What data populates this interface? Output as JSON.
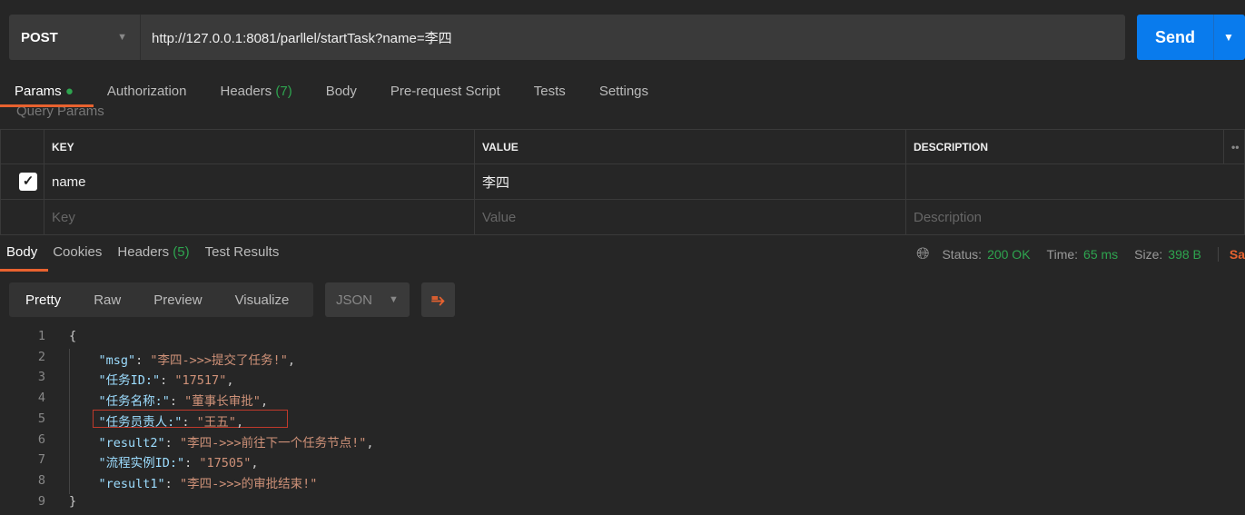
{
  "request": {
    "method": "POST",
    "url": "http://127.0.0.1:8081/parllel/startTask?name=李四",
    "send_label": "Send"
  },
  "request_tabs": [
    {
      "label": "Params",
      "active": true,
      "dot": true
    },
    {
      "label": "Authorization"
    },
    {
      "label": "Headers",
      "count": "(7)"
    },
    {
      "label": "Body"
    },
    {
      "label": "Pre-request Script"
    },
    {
      "label": "Tests"
    },
    {
      "label": "Settings"
    }
  ],
  "query_params": {
    "title": "Query Params",
    "headers": [
      "KEY",
      "VALUE",
      "DESCRIPTION"
    ],
    "rows": [
      {
        "checked": true,
        "key": "name",
        "value": "李四",
        "description": ""
      }
    ],
    "placeholders": {
      "key": "Key",
      "value": "Value",
      "description": "Description"
    }
  },
  "response_tabs": [
    {
      "label": "Body",
      "active": true
    },
    {
      "label": "Cookies"
    },
    {
      "label": "Headers",
      "count": "(5)"
    },
    {
      "label": "Test Results"
    }
  ],
  "response_meta": {
    "status_label": "Status:",
    "status": "200 OK",
    "time_label": "Time:",
    "time": "65 ms",
    "size_label": "Size:",
    "size": "398 B",
    "save_label": "Sa"
  },
  "view_modes": [
    "Pretty",
    "Raw",
    "Preview",
    "Visualize"
  ],
  "format": "JSON",
  "code_lines": [
    {
      "n": "1",
      "parts": [
        [
          "p",
          "{"
        ]
      ]
    },
    {
      "n": "2",
      "parts": [
        [
          "p",
          "    "
        ],
        [
          "k",
          "\"msg\""
        ],
        [
          "p",
          ": "
        ],
        [
          "s",
          "\"李四->>>提交了任务!\""
        ],
        [
          "p",
          ","
        ]
      ]
    },
    {
      "n": "3",
      "parts": [
        [
          "p",
          "    "
        ],
        [
          "k",
          "\"任务ID:\""
        ],
        [
          "p",
          ": "
        ],
        [
          "s",
          "\"17517\""
        ],
        [
          "p",
          ","
        ]
      ]
    },
    {
      "n": "4",
      "parts": [
        [
          "p",
          "    "
        ],
        [
          "k",
          "\"任务名称:\""
        ],
        [
          "p",
          ": "
        ],
        [
          "s",
          "\"董事长审批\""
        ],
        [
          "p",
          ","
        ]
      ]
    },
    {
      "n": "5",
      "parts": [
        [
          "p",
          "    "
        ],
        [
          "k",
          "\"任务员责人:\""
        ],
        [
          "p",
          ": "
        ],
        [
          "s",
          "\"王五\""
        ],
        [
          "p",
          ","
        ]
      ]
    },
    {
      "n": "6",
      "parts": [
        [
          "p",
          "    "
        ],
        [
          "k",
          "\"result2\""
        ],
        [
          "p",
          ": "
        ],
        [
          "s",
          "\"李四->>>前往下一个任务节点!\""
        ],
        [
          "p",
          ","
        ]
      ]
    },
    {
      "n": "7",
      "parts": [
        [
          "p",
          "    "
        ],
        [
          "k",
          "\"流程实例ID:\""
        ],
        [
          "p",
          ": "
        ],
        [
          "s",
          "\"17505\""
        ],
        [
          "p",
          ","
        ]
      ]
    },
    {
      "n": "8",
      "parts": [
        [
          "p",
          "    "
        ],
        [
          "k",
          "\"result1\""
        ],
        [
          "p",
          ": "
        ],
        [
          "s",
          "\"李四->>>的审批结束!\""
        ]
      ]
    },
    {
      "n": "9",
      "parts": [
        [
          "p",
          "}"
        ]
      ]
    }
  ],
  "colors": {
    "accent": "#e8622f",
    "send": "#097bed",
    "success": "#2ea44f",
    "json_key": "#9cdcfe",
    "json_string": "#ce9178",
    "highlight_box": "#c0392b"
  }
}
